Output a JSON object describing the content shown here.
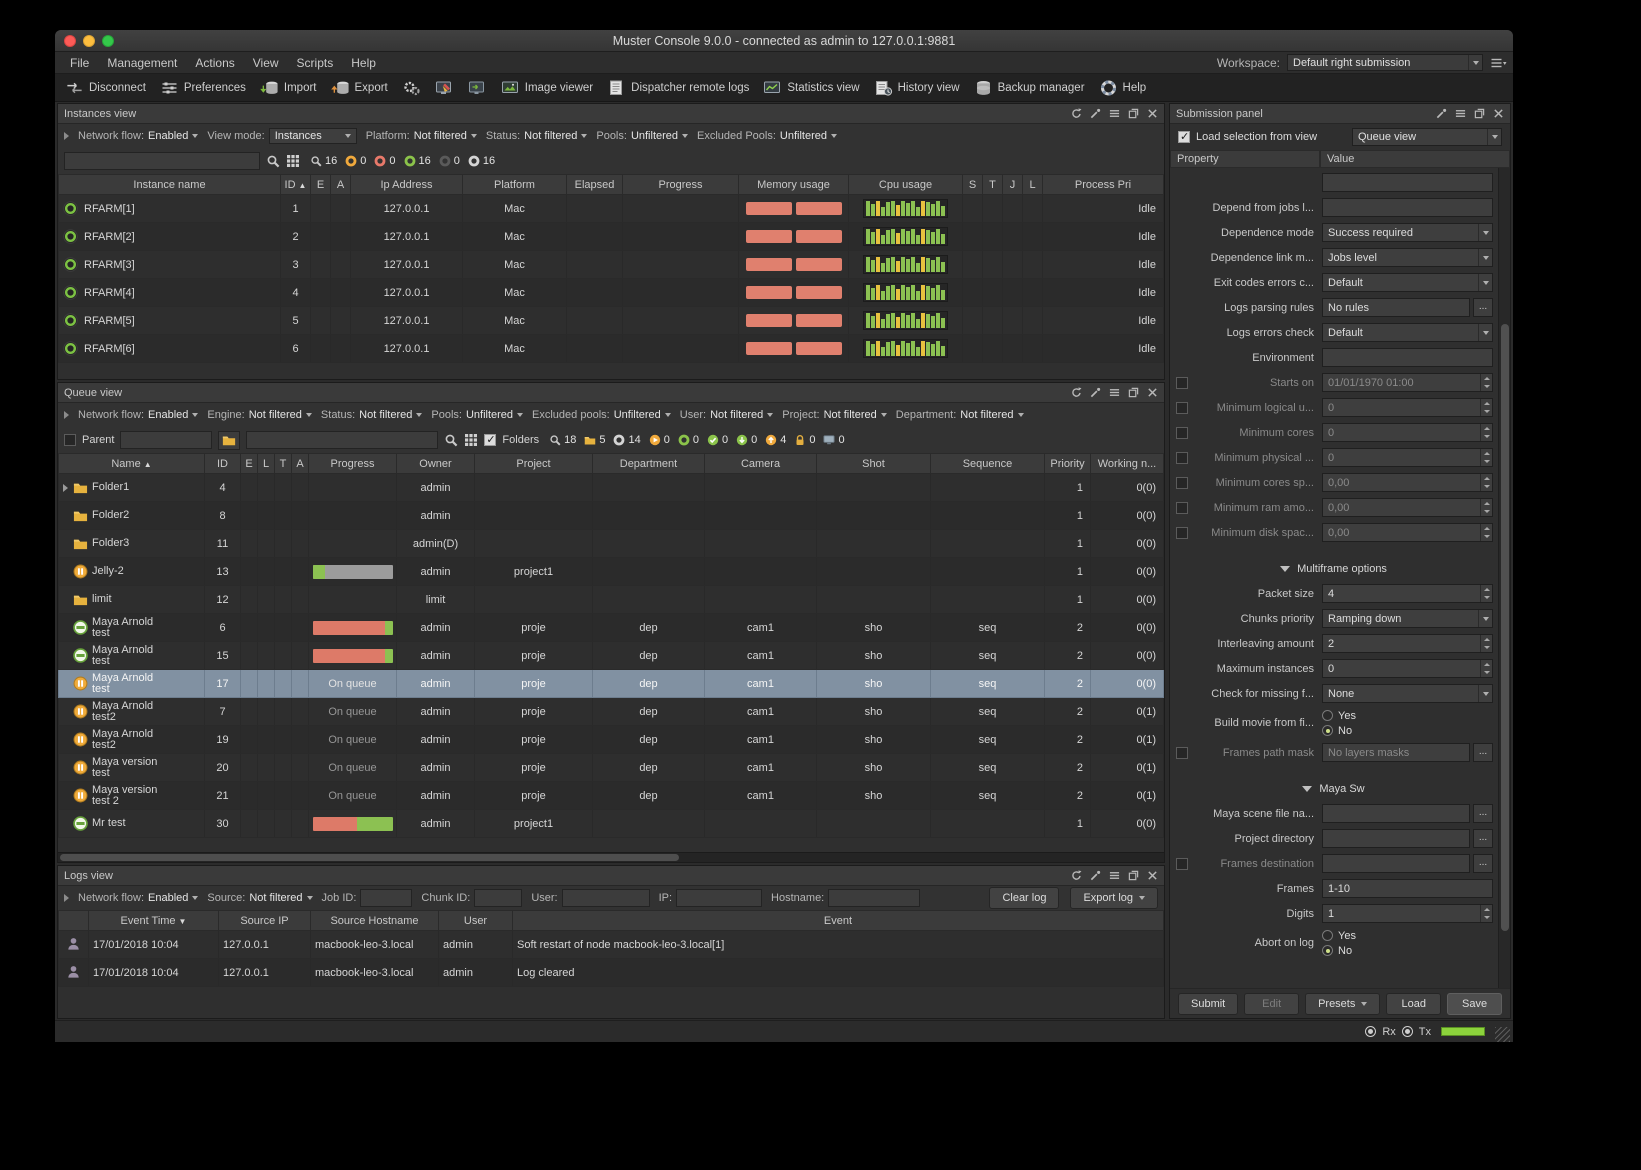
{
  "window": {
    "title": "Muster Console 9.0.0 - connected as admin to 127.0.0.1:9881"
  },
  "menubar": {
    "items": [
      "File",
      "Management",
      "Actions",
      "View",
      "Scripts",
      "Help"
    ],
    "workspace_label": "Workspace:",
    "workspace_value": "Default right submission"
  },
  "toolbar": [
    {
      "icon": "disconnect",
      "label": "Disconnect"
    },
    {
      "icon": "preferences",
      "label": "Preferences"
    },
    {
      "icon": "import",
      "label": "Import"
    },
    {
      "icon": "export",
      "label": "Export"
    },
    {
      "icon": "services",
      "label": ""
    },
    {
      "icon": "node-editor",
      "label": ""
    },
    {
      "icon": "remote-control",
      "label": ""
    },
    {
      "icon": "image-viewer",
      "label": "Image viewer"
    },
    {
      "icon": "dispatcher-logs",
      "label": "Dispatcher remote logs"
    },
    {
      "icon": "statistics",
      "label": "Statistics view"
    },
    {
      "icon": "history",
      "label": "History view"
    },
    {
      "icon": "backup",
      "label": "Backup manager"
    },
    {
      "icon": "help",
      "label": "Help"
    }
  ],
  "instances_view": {
    "title": "Instances view",
    "filters": [
      {
        "label": "Network flow:",
        "value": "Enabled"
      },
      {
        "label": "View mode:",
        "value": "Instances",
        "boxed": true
      },
      {
        "label": "Platform:",
        "value": "Not filtered"
      },
      {
        "label": "Status:",
        "value": "Not filtered"
      },
      {
        "label": "Pools:",
        "value": "Unfiltered"
      },
      {
        "label": "Excluded Pools:",
        "value": "Unfiltered"
      }
    ],
    "counts": [
      {
        "icon": "search",
        "value": "16"
      },
      {
        "icon": "dot-orange",
        "value": "0"
      },
      {
        "icon": "dot-red",
        "value": "0"
      },
      {
        "icon": "dot-green",
        "value": "16"
      },
      {
        "icon": "dot-dark",
        "value": "0"
      },
      {
        "icon": "dot-outline",
        "value": "16"
      }
    ],
    "columns": [
      "Instance name",
      "ID",
      "E",
      "A",
      "Ip Address",
      "Platform",
      "Elapsed",
      "Progress",
      "Memory usage",
      "Cpu usage",
      "S",
      "T",
      "J",
      "L",
      "Process Pri"
    ],
    "sort": {
      "column": "ID",
      "dir": "asc"
    },
    "memory_bars": [
      46,
      46
    ],
    "cpu_pattern": [
      "g",
      "g",
      "y",
      "g",
      "g",
      "g",
      "y",
      "g",
      "g",
      "g",
      "g",
      "y",
      "g",
      "g",
      "g",
      "g"
    ],
    "rows": [
      {
        "name": "RFARM[1]",
        "id": "1",
        "ip": "127.0.0.1",
        "platform": "Mac",
        "process_pri": "Idle"
      },
      {
        "name": "RFARM[2]",
        "id": "2",
        "ip": "127.0.0.1",
        "platform": "Mac",
        "process_pri": "Idle"
      },
      {
        "name": "RFARM[3]",
        "id": "3",
        "ip": "127.0.0.1",
        "platform": "Mac",
        "process_pri": "Idle"
      },
      {
        "name": "RFARM[4]",
        "id": "4",
        "ip": "127.0.0.1",
        "platform": "Mac",
        "process_pri": "Idle"
      },
      {
        "name": "RFARM[5]",
        "id": "5",
        "ip": "127.0.0.1",
        "platform": "Mac",
        "process_pri": "Idle"
      },
      {
        "name": "RFARM[6]",
        "id": "6",
        "ip": "127.0.0.1",
        "platform": "Mac",
        "process_pri": "Idle"
      }
    ]
  },
  "queue_view": {
    "title": "Queue view",
    "parent_label": "Parent",
    "folders_label": "Folders",
    "filters": [
      {
        "label": "Network flow:",
        "value": "Enabled"
      },
      {
        "label": "Engine:",
        "value": "Not filtered"
      },
      {
        "label": "Status:",
        "value": "Not filtered"
      },
      {
        "label": "Pools:",
        "value": "Unfiltered"
      },
      {
        "label": "Excluded pools:",
        "value": "Unfiltered"
      },
      {
        "label": "User:",
        "value": "Not filtered"
      },
      {
        "label": "Project:",
        "value": "Not filtered"
      },
      {
        "label": "Department:",
        "value": "Not filtered"
      }
    ],
    "counts": [
      {
        "icon": "search",
        "value": "18"
      },
      {
        "icon": "folder",
        "value": "5"
      },
      {
        "icon": "dot-outline",
        "value": "14"
      },
      {
        "icon": "dot-orange-play",
        "value": "0"
      },
      {
        "icon": "dot-green",
        "value": "0"
      },
      {
        "icon": "dot-check",
        "value": "0"
      },
      {
        "icon": "dot-down",
        "value": "0"
      },
      {
        "icon": "dot-up",
        "value": "4"
      },
      {
        "icon": "lock",
        "value": "0"
      },
      {
        "icon": "monitor",
        "value": "0"
      }
    ],
    "columns": [
      "Name",
      "ID",
      "E",
      "L",
      "T",
      "A",
      "Progress",
      "Owner",
      "Project",
      "Department",
      "Camera",
      "Shot",
      "Sequence",
      "Priority",
      "Working n..."
    ],
    "sort": {
      "column": "Name",
      "dir": "asc"
    },
    "rows": [
      {
        "icon": "folder",
        "expand": true,
        "name": "Folder1",
        "id": "4",
        "owner": "admin",
        "priority": "1",
        "working": "0(0)"
      },
      {
        "icon": "folder",
        "name": "Folder2",
        "id": "8",
        "owner": "admin",
        "priority": "1",
        "working": "0(0)"
      },
      {
        "icon": "folder",
        "name": "Folder3",
        "id": "11",
        "owner": "admin(D)",
        "priority": "1",
        "working": "0(0)"
      },
      {
        "icon": "pause",
        "name": "Jelly-2",
        "id": "13",
        "progress": {
          "segments": [
            [
              "green",
              15
            ]
          ],
          "track": true
        },
        "owner": "admin",
        "project": "project1",
        "priority": "1",
        "working": "0(0)"
      },
      {
        "icon": "folder",
        "name": "limit",
        "id": "12",
        "owner": "limit",
        "priority": "1",
        "working": "0(0)"
      },
      {
        "icon": "green",
        "name": "Maya Arnold test",
        "id": "6",
        "progress": {
          "segments": [
            [
              "red",
              90
            ],
            [
              "green",
              10
            ]
          ]
        },
        "owner": "admin",
        "project": "proje",
        "department": "dep",
        "camera": "cam1",
        "shot": "sho",
        "sequence": "seq",
        "priority": "2",
        "working": "0(0)"
      },
      {
        "icon": "green",
        "name": "Maya Arnold test",
        "id": "15",
        "progress": {
          "segments": [
            [
              "red",
              90
            ],
            [
              "green",
              10
            ]
          ]
        },
        "owner": "admin",
        "project": "proje",
        "department": "dep",
        "camera": "cam1",
        "shot": "sho",
        "sequence": "seq",
        "priority": "2",
        "working": "0(0)"
      },
      {
        "icon": "pause",
        "name": "Maya Arnold test",
        "id": "17",
        "selected": true,
        "progress": {
          "text": "On queue"
        },
        "owner": "admin",
        "project": "proje",
        "department": "dep",
        "camera": "cam1",
        "shot": "sho",
        "sequence": "seq",
        "priority": "2",
        "working": "0(0)"
      },
      {
        "icon": "pause",
        "name": "Maya Arnold test2",
        "id": "7",
        "progress": {
          "text": "On queue"
        },
        "owner": "admin",
        "project": "proje",
        "department": "dep",
        "camera": "cam1",
        "shot": "sho",
        "sequence": "seq",
        "priority": "2",
        "working": "0(1)"
      },
      {
        "icon": "pause",
        "name": "Maya Arnold test2",
        "id": "19",
        "progress": {
          "text": "On queue"
        },
        "owner": "admin",
        "project": "proje",
        "department": "dep",
        "camera": "cam1",
        "shot": "sho",
        "sequence": "seq",
        "priority": "2",
        "working": "0(1)"
      },
      {
        "icon": "pause",
        "name": "Maya version test",
        "id": "20",
        "progress": {
          "text": "On queue"
        },
        "owner": "admin",
        "project": "proje",
        "department": "dep",
        "camera": "cam1",
        "shot": "sho",
        "sequence": "seq",
        "priority": "2",
        "working": "0(1)"
      },
      {
        "icon": "pause",
        "name": "Maya version test 2",
        "id": "21",
        "progress": {
          "text": "On queue"
        },
        "owner": "admin",
        "project": "proje",
        "department": "dep",
        "camera": "cam1",
        "shot": "sho",
        "sequence": "seq",
        "priority": "2",
        "working": "0(1)"
      },
      {
        "icon": "green",
        "name": "Mr test",
        "id": "30",
        "progress": {
          "segments": [
            [
              "red",
              55
            ],
            [
              "green",
              45
            ]
          ]
        },
        "owner": "admin",
        "project": "project1",
        "priority": "1",
        "working": "0(0)"
      }
    ]
  },
  "logs_view": {
    "title": "Logs view",
    "filters_selects": [
      {
        "label": "Network flow:",
        "value": "Enabled"
      },
      {
        "label": "Source:",
        "value": "Not filtered"
      }
    ],
    "filters_inputs": [
      "Job ID:",
      "Chunk ID:",
      "User:",
      "IP:",
      "Hostname:"
    ],
    "buttons": [
      "Clear log",
      "Export log"
    ],
    "columns": [
      "Event Time",
      "Source IP",
      "Source Hostname",
      "User",
      "Event"
    ],
    "sort": {
      "column": "Event Time",
      "dir": "desc"
    },
    "rows": [
      {
        "time": "17/01/2018 10:04",
        "ip": "127.0.0.1",
        "hostname": "macbook-leo-3.local",
        "user": "admin",
        "event": "Soft restart of node macbook-leo-3.local[1]"
      },
      {
        "time": "17/01/2018 10:04",
        "ip": "127.0.0.1",
        "hostname": "macbook-leo-3.local",
        "user": "admin",
        "event": "Log cleared"
      }
    ]
  },
  "submission_panel": {
    "title": "Submission panel",
    "load_selection_label": "Load selection from view",
    "view_select_value": "Queue view",
    "columns": [
      "Property",
      "Value"
    ],
    "properties": [
      {
        "type": "input",
        "label": "",
        "value": ""
      },
      {
        "type": "input",
        "label": "Depend from jobs l...",
        "value": ""
      },
      {
        "type": "select",
        "label": "Dependence mode",
        "value": "Success required"
      },
      {
        "type": "select",
        "label": "Dependence link m...",
        "value": "Jobs level"
      },
      {
        "type": "select",
        "label": "Exit codes errors c...",
        "value": "Default"
      },
      {
        "type": "input-browse",
        "label": "Logs parsing rules",
        "value": "No rules"
      },
      {
        "type": "select",
        "label": "Logs errors check",
        "value": "Default"
      },
      {
        "type": "input",
        "label": "Environment",
        "value": ""
      },
      {
        "type": "spinner",
        "label": "Starts on",
        "value": "01/01/1970 01:00",
        "checkbox": true,
        "dim": true
      },
      {
        "type": "spinner",
        "label": "Minimum logical u...",
        "value": "0",
        "checkbox": true,
        "dim": true
      },
      {
        "type": "spinner",
        "label": "Minimum cores",
        "value": "0",
        "checkbox": true,
        "dim": true
      },
      {
        "type": "spinner",
        "label": "Minimum physical ...",
        "value": "0",
        "checkbox": true,
        "dim": true
      },
      {
        "type": "spinner",
        "label": "Minimum cores sp...",
        "value": "0,00",
        "checkbox": true,
        "dim": true
      },
      {
        "type": "spinner",
        "label": "Minimum ram amo...",
        "value": "0,00",
        "checkbox": true,
        "dim": true
      },
      {
        "type": "spinner",
        "label": "Minimum disk spac...",
        "value": "0,00",
        "checkbox": true,
        "dim": true
      },
      {
        "type": "section",
        "label": "Multiframe options"
      },
      {
        "type": "spinner",
        "label": "Packet size",
        "value": "4"
      },
      {
        "type": "select",
        "label": "Chunks priority",
        "value": "Ramping down"
      },
      {
        "type": "spinner",
        "label": "Interleaving amount",
        "value": "2"
      },
      {
        "type": "spinner",
        "label": "Maximum instances",
        "value": "0"
      },
      {
        "type": "select",
        "label": "Check for missing f...",
        "value": "None"
      },
      {
        "type": "radio",
        "label": "Build movie from fi...",
        "options": [
          "Yes",
          "No"
        ],
        "selected": "No"
      },
      {
        "type": "input-browse",
        "label": "Frames path mask",
        "value": "No layers masks",
        "checkbox": true,
        "dim": true
      },
      {
        "type": "section",
        "label": "Maya Sw"
      },
      {
        "type": "input-browse",
        "label": "Maya scene file na...",
        "value": ""
      },
      {
        "type": "input-browse",
        "label": "Project directory",
        "value": ""
      },
      {
        "type": "input-browse",
        "label": "Frames destination",
        "value": "",
        "checkbox": true,
        "dim": true
      },
      {
        "type": "input",
        "label": "Frames",
        "value": "1-10"
      },
      {
        "type": "spinner",
        "label": "Digits",
        "value": "1"
      },
      {
        "type": "radio",
        "label": "Abort on log",
        "options": [
          "Yes",
          "No"
        ],
        "selected": "No"
      }
    ],
    "buttons": [
      "Submit",
      "Edit",
      "Presets",
      "Load",
      "Save"
    ]
  },
  "statusbar": {
    "rx_label": "Rx",
    "tx_label": "Tx"
  }
}
